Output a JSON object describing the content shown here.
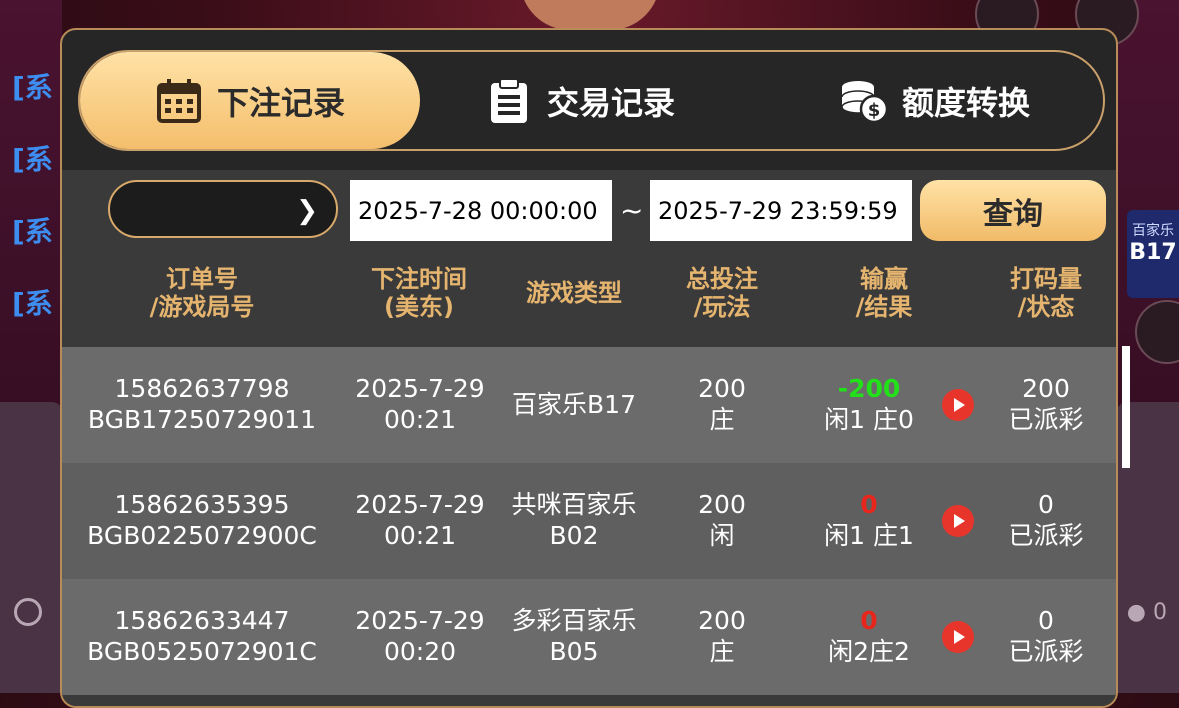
{
  "background": {
    "left_labels": [
      "[系",
      "[系",
      "[系",
      "[系"
    ],
    "badge_text": "百家乐",
    "badge_code": "B17",
    "user_count": "0"
  },
  "tabs": [
    {
      "label": "下注记录",
      "icon": "calendar-icon",
      "active": true
    },
    {
      "label": "交易记录",
      "icon": "clipboard-icon",
      "active": false
    },
    {
      "label": "额度转换",
      "icon": "coins-dollar-icon",
      "active": false
    }
  ],
  "filter": {
    "select_value": "",
    "start_time": "2025-7-28 00:00:00",
    "separator": "~",
    "end_time": "2025-7-29 23:59:59",
    "query_label": "查询"
  },
  "table": {
    "headers": [
      [
        "订单号",
        "/游戏局号"
      ],
      [
        "下注时间",
        "(美东)"
      ],
      [
        "游戏类型",
        ""
      ],
      [
        "总投注",
        "/玩法"
      ],
      [
        "输赢",
        "/结果"
      ],
      [
        "打码量",
        "/状态"
      ]
    ],
    "rows": [
      {
        "order": "15862637798",
        "round": "BGB17250729011",
        "date": "2025-7-29",
        "time": "00:21",
        "game": "百家乐B17",
        "game2": "",
        "bet": "200",
        "play": "庄",
        "win": "-200",
        "win_color": "#22e01a",
        "result": "闲1 庄0",
        "turnover": "200",
        "status": "已派彩"
      },
      {
        "order": "15862635395",
        "round": "BGB0225072900C",
        "date": "2025-7-29",
        "time": "00:21",
        "game": "共咪百家乐",
        "game2": "B02",
        "bet": "200",
        "play": "闲",
        "win": "0",
        "win_color": "#e8261c",
        "result": "闲1 庄1",
        "turnover": "0",
        "status": "已派彩"
      },
      {
        "order": "15862633447",
        "round": "BGB0525072901C",
        "date": "2025-7-29",
        "time": "00:20",
        "game": "多彩百家乐",
        "game2": "B05",
        "bet": "200",
        "play": "庄",
        "win": "0",
        "win_color": "#e8261c",
        "result": "闲2庄2",
        "turnover": "0",
        "status": "已派彩"
      }
    ]
  },
  "colors": {
    "accent_gold": "#f4be6c",
    "header_text": "#e5b46f",
    "play_button": "#e8352c"
  }
}
